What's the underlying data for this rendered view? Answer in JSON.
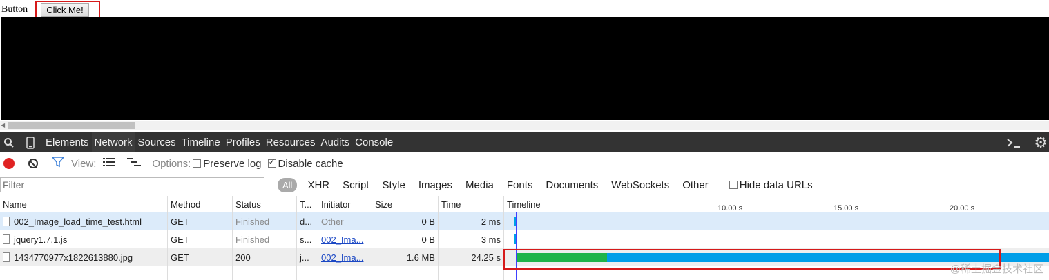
{
  "page": {
    "label": "Button",
    "button_label": "Click Me!"
  },
  "devtools": {
    "tabs": [
      "Elements",
      "Network",
      "Sources",
      "Timeline",
      "Profiles",
      "Resources",
      "Audits",
      "Console"
    ],
    "active_tab": "Network"
  },
  "toolbar": {
    "view_label": "View:",
    "options_label": "Options:",
    "preserve_log": "Preserve log",
    "disable_cache": "Disable cache",
    "preserve_log_checked": false,
    "disable_cache_checked": true
  },
  "filter": {
    "placeholder": "Filter",
    "types": [
      "All",
      "XHR",
      "Script",
      "Style",
      "Images",
      "Media",
      "Fonts",
      "Documents",
      "WebSockets",
      "Other"
    ],
    "hide_data_urls": "Hide data URLs"
  },
  "table": {
    "headers": {
      "name": "Name",
      "method": "Method",
      "status": "Status",
      "type": "T...",
      "initiator": "Initiator",
      "size": "Size",
      "time": "Time",
      "timeline": "Timeline"
    },
    "timeline_ticks": [
      "10.00 s",
      "15.00 s",
      "20.00 s"
    ],
    "rows": [
      {
        "name": "002_Image_load_time_test.html",
        "method": "GET",
        "status": "Finished",
        "type": "d...",
        "initiator": "Other",
        "size": "0 B",
        "time": "2 ms"
      },
      {
        "name": "jquery1.7.1.js",
        "method": "GET",
        "status": "Finished",
        "type": "s...",
        "initiator": "002_Ima...",
        "size": "0 B",
        "time": "3 ms"
      },
      {
        "name": "1434770977x1822613880.jpg",
        "method": "GET",
        "status": "200",
        "type": "j...",
        "initiator": "002_Ima...",
        "size": "1.6 MB",
        "time": "24.25 s"
      }
    ]
  },
  "watermark": "@稀土掘金技术社区",
  "colors": {
    "accent_red": "#d61a1a",
    "bar_green": "#1fb44a",
    "bar_blue": "#009ee8"
  }
}
